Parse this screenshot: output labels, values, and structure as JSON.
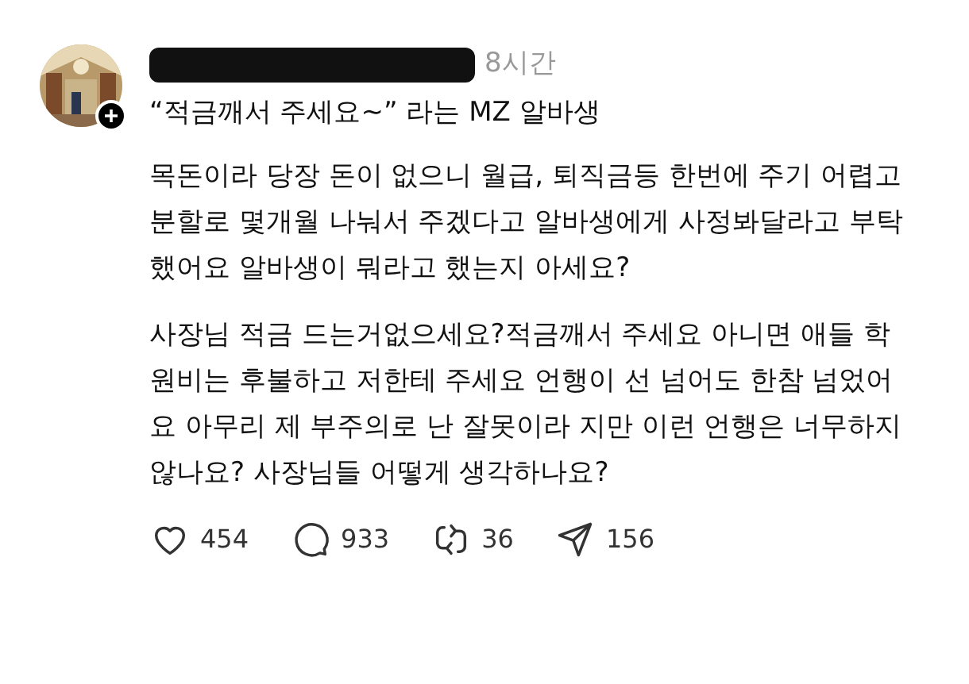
{
  "post": {
    "time": "8시간",
    "title": "“적금깨서 주세요~” 라는 MZ 알바생",
    "paragraphs": [
      "목돈이라 당장 돈이 없으니 월급, 퇴직금등 한번에 주기 어렵고 분할로 몇개월 나눠서 주겠다고 알바생에게 사정봐달라고 부탁했어요 알바생이 뭐라고 했는지 아세요?",
      "사장님 적금 드는거없으세요?적금깨서 주세요 아니면 애들 학원비는 후불하고 저한테 주세요 언행이 선 넘어도 한참 넘었어요 아무리 제 부주의로 난 잘못이라 지만 이런 언행은 너무하지 않나요? 사장님들 어떻게 생각하나요?"
    ],
    "actions": [
      {
        "kind": "like",
        "count": "454"
      },
      {
        "kind": "reply",
        "count": "933"
      },
      {
        "kind": "repost",
        "count": "36"
      },
      {
        "kind": "share",
        "count": "156"
      }
    ]
  }
}
